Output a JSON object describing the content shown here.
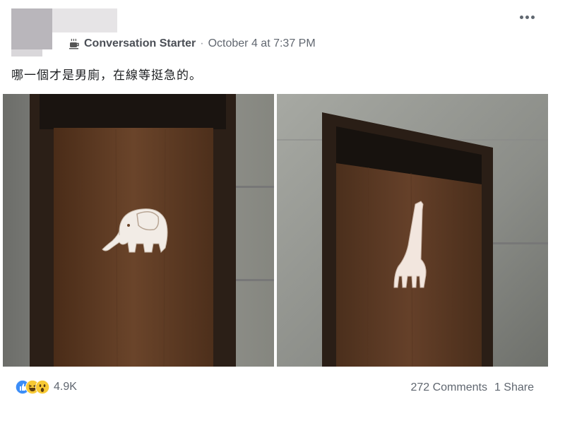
{
  "post": {
    "author": "Conversation Starter",
    "separator": "·",
    "date": "October 4 at 7:37 PM",
    "text": "哪一個才是男廁，在線等挺急的。",
    "more_icon": "more-dots-icon",
    "page_icon": "coffee-cup-icon"
  },
  "photos": [
    {
      "subject": "elephant-sign-door"
    },
    {
      "subject": "giraffe-sign-door"
    }
  ],
  "footer": {
    "reactions": [
      "like-reaction-icon",
      "haha-reaction-icon",
      "wow-reaction-icon"
    ],
    "reaction_count": "4.9K",
    "comments": "272 Comments",
    "shares": "1 Share"
  },
  "colors": {
    "like": "#3b8df7",
    "haha": "#f7c934",
    "wood": "#5a3a22"
  }
}
